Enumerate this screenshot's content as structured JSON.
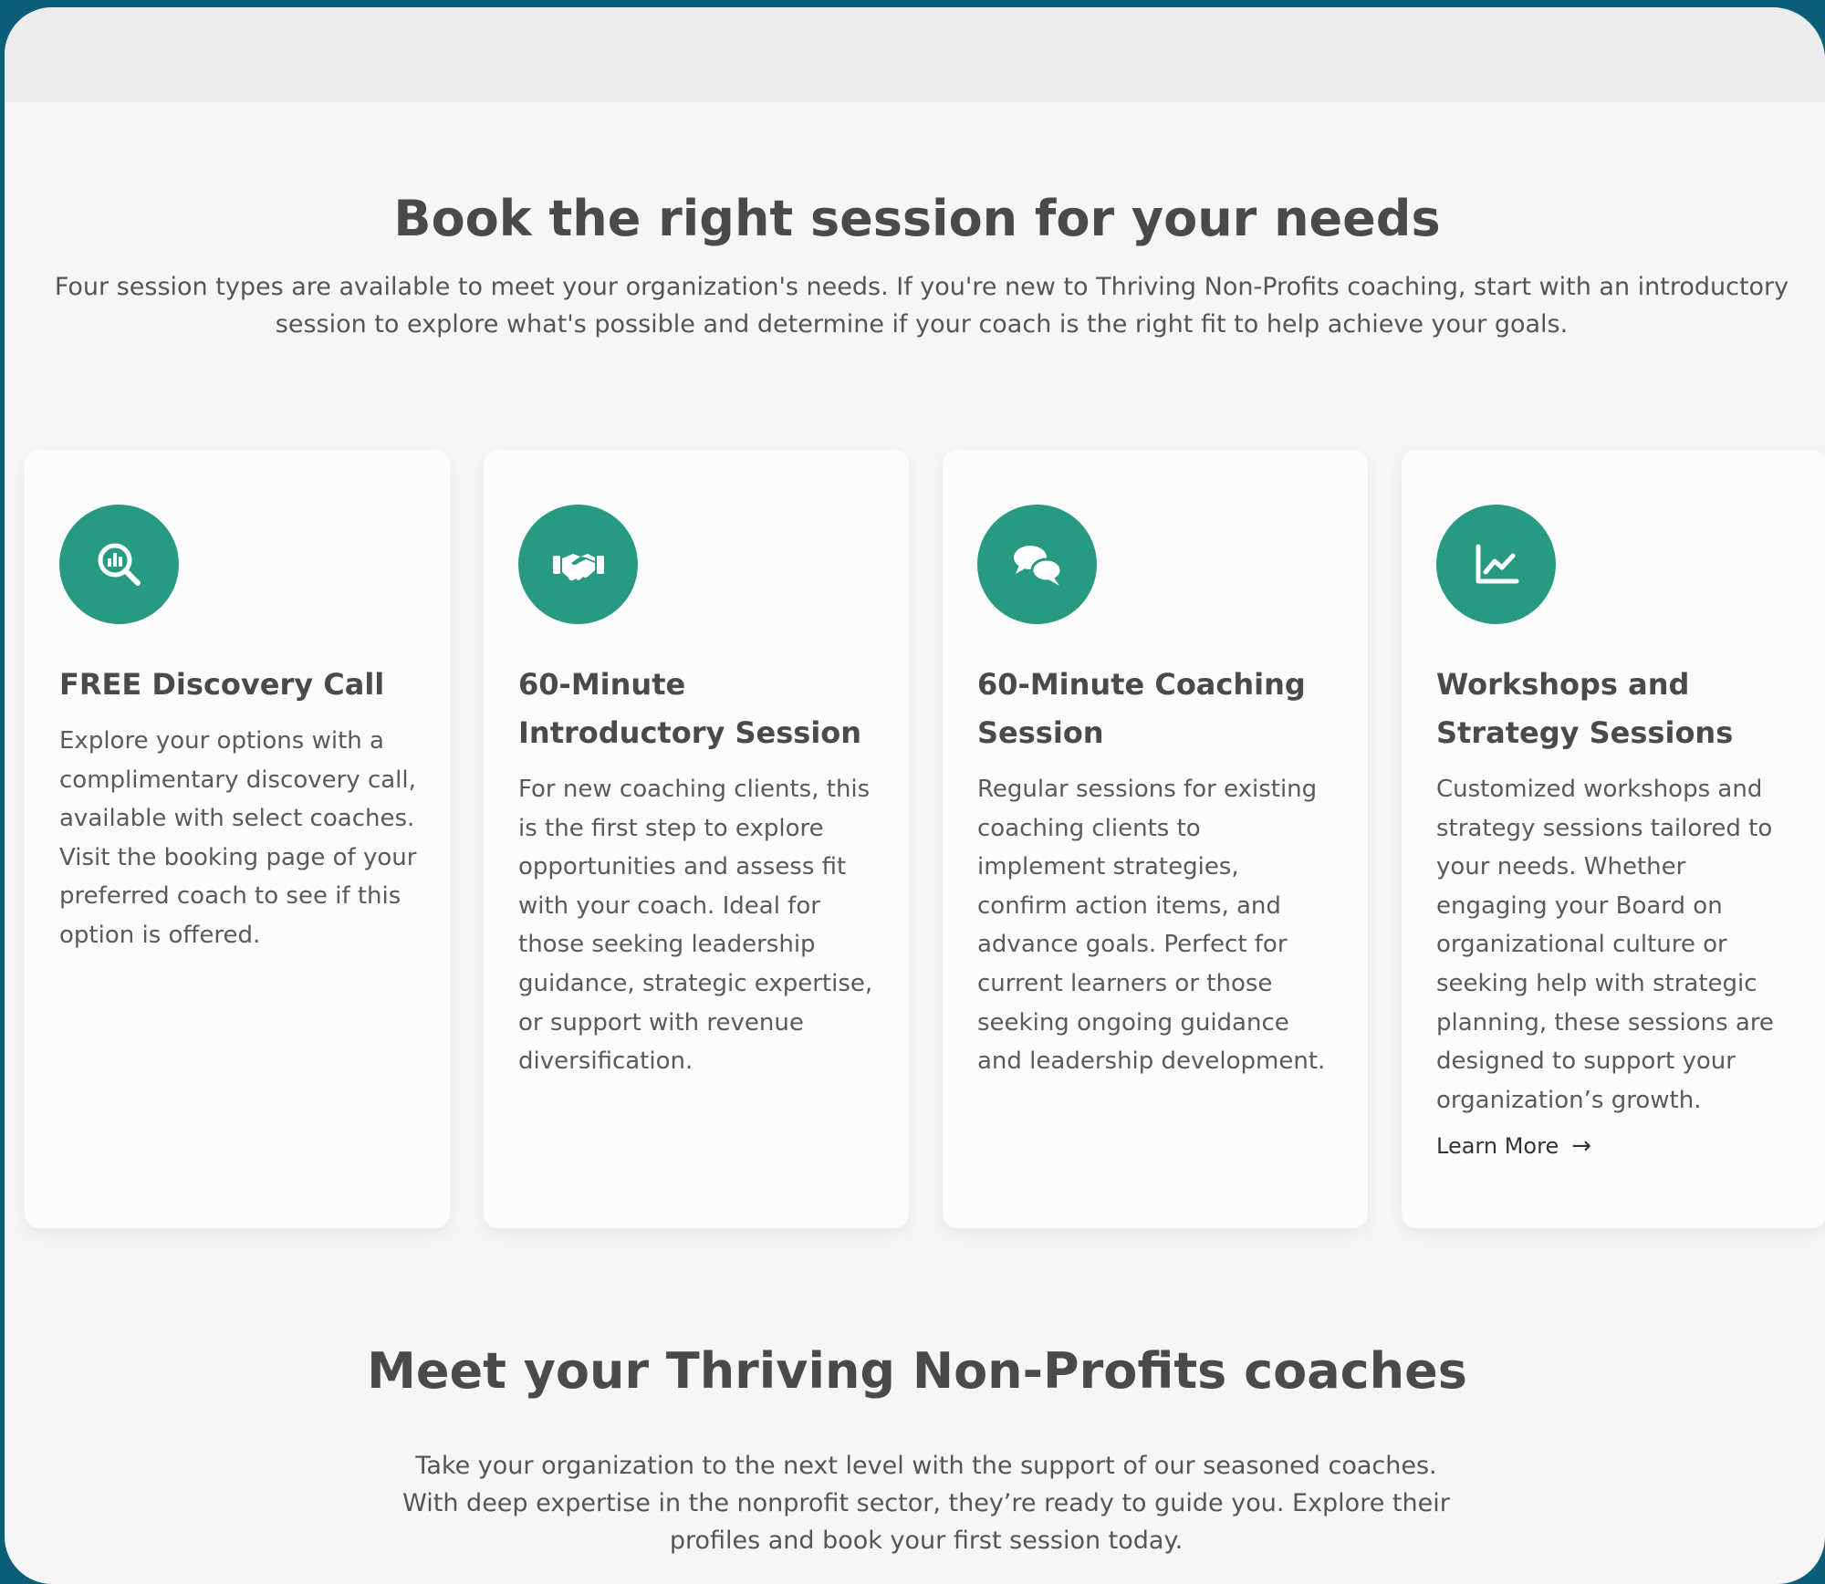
{
  "sessions_section": {
    "title": "Book the right session for your needs",
    "intro": "Four session types are available to meet your organization's needs. If you're new to Thriving Non-Profits coaching, start with an introductory session to explore what's possible and determine if your coach is the right fit to help achieve your goals."
  },
  "cards": [
    {
      "icon": "search-chart-icon",
      "title": "FREE Discovery Call",
      "body": "Explore your options with a complimentary discovery call, available with select coaches. Visit the booking page of your preferred coach to see if this option is offered."
    },
    {
      "icon": "handshake-icon",
      "title": "60-Minute Introductory Session",
      "body": "For new coaching clients, this is the first step to explore opportunities and assess fit with your coach. Ideal for those seeking leadership guidance, strategic expertise, or support with revenue diversification."
    },
    {
      "icon": "chat-bubbles-icon",
      "title": "60-Minute Coaching Session",
      "body": "Regular sessions for existing coaching clients to implement strategies, confirm action items, and advance goals. Perfect for current learners or those seeking ongoing guidance and leadership development."
    },
    {
      "icon": "line-chart-icon",
      "title": "Workshops and Strategy Sessions",
      "body": "Customized workshops and strategy sessions tailored to your needs. Whether engaging your Board on organizational culture or seeking help with strategic planning, these sessions are designed to support your organization’s growth.",
      "link_label": "Learn More",
      "link_icon": "arrow-right-icon"
    }
  ],
  "coaches_section": {
    "title": "Meet your Thriving Non-Profits coaches",
    "intro": "Take your organization to the next level with the support of our seasoned coaches. With deep expertise in the nonprofit sector, they’re ready to guide you. Explore their profiles and book your first session today."
  },
  "colors": {
    "accent": "#279a81",
    "frame_border": "#0b5e78",
    "background": "#f6f6f6",
    "card": "#fcfcfc"
  }
}
